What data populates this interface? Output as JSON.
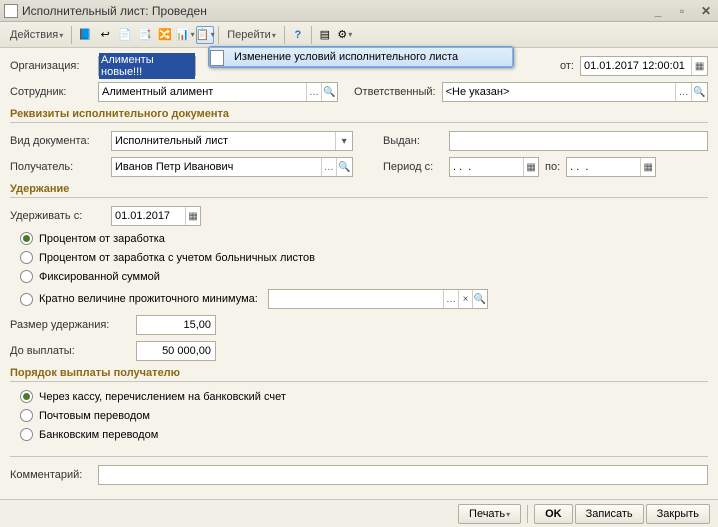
{
  "window": {
    "title": "Исполнительный лист: Проведен"
  },
  "toolbar": {
    "actions": "Действия",
    "go": "Перейти",
    "menu_item": "Изменение условий исполнительного листа"
  },
  "header": {
    "org_label": "Организация:",
    "org_value": "Алименты новые!!!",
    "from_label": "от:",
    "from_value": "01.01.2017 12:00:01",
    "emp_label": "Сотрудник:",
    "emp_value": "Алиментный алимент",
    "resp_label": "Ответственный:",
    "resp_value": "<Не указан>"
  },
  "req": {
    "title": "Реквизиты исполнительного документа",
    "doctype_label": "Вид документа:",
    "doctype_value": "Исполнительный лист",
    "issued_label": "Выдан:",
    "recipient_label": "Получатель:",
    "recipient_value": "Иванов Петр Иванович",
    "period_from_label": "Период с:",
    "period_to_label": "по:",
    "period_from_value": ". .  .",
    "period_to_value": ". .  ."
  },
  "withhold": {
    "title": "Удержание",
    "from_label": "Удерживать с:",
    "from_value": "01.01.2017",
    "opt1": "Процентом от заработка",
    "opt2": "Процентом от заработка с учетом больничных листов",
    "opt3": "Фиксированной суммой",
    "opt4": "Кратно величине прожиточного минимума:",
    "size_label": "Размер удержания:",
    "size_value": "15,00",
    "until_label": "До выплаты:",
    "until_value": "50 000,00"
  },
  "payout": {
    "title": "Порядок выплаты получателю",
    "opt1": "Через кассу, перечислением на банковский счет",
    "opt2": "Почтовым переводом",
    "opt3": "Банковским переводом"
  },
  "comment_label": "Комментарий:",
  "footer": {
    "print": "Печать",
    "ok": "OK",
    "save": "Записать",
    "close": "Закрыть"
  }
}
